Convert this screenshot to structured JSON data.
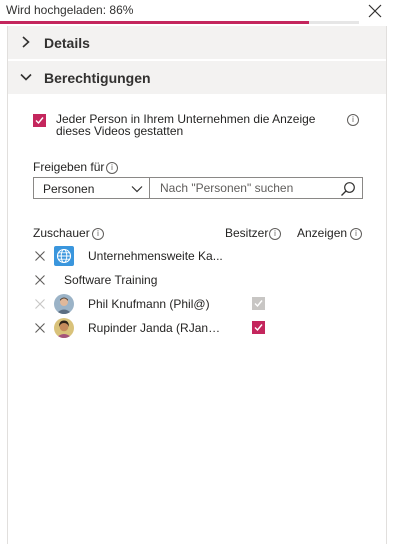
{
  "upload": {
    "status_text": "Wird hochgeladen: 86%",
    "progress": 0.86,
    "progress_color": "#c4265d"
  },
  "sections": {
    "details": {
      "title": "Details"
    },
    "permissions": {
      "title": "Berechtigungen"
    }
  },
  "allow_org": {
    "checked": true,
    "label": "Jeder Person in Ihrem Unternehmen die Anzeige dieses Videos gestatten"
  },
  "share": {
    "label": "Freigeben für",
    "select_value": "Personen",
    "search_placeholder": "Nach \"Personen\" suchen"
  },
  "columns": {
    "viewer": "Zuschauer",
    "owner": "Besitzer",
    "view": "Anzeigen"
  },
  "viewers": [
    {
      "name": "Unternehmensweite Ka...",
      "icon": "globe-icon",
      "owner_checkbox": "none"
    },
    {
      "name": "Software Training",
      "icon": "none",
      "owner_checkbox": "none"
    },
    {
      "name": "Phil Knufmann (Phil@)",
      "icon": "avatar-photo",
      "owner_checkbox": "checked-disabled"
    },
    {
      "name": "Rupinder Janda (RJanda...",
      "icon": "avatar-photo",
      "owner_checkbox": "checked"
    }
  ],
  "colors": {
    "accent": "#c4265d",
    "header_bg": "#f3f2f1"
  }
}
